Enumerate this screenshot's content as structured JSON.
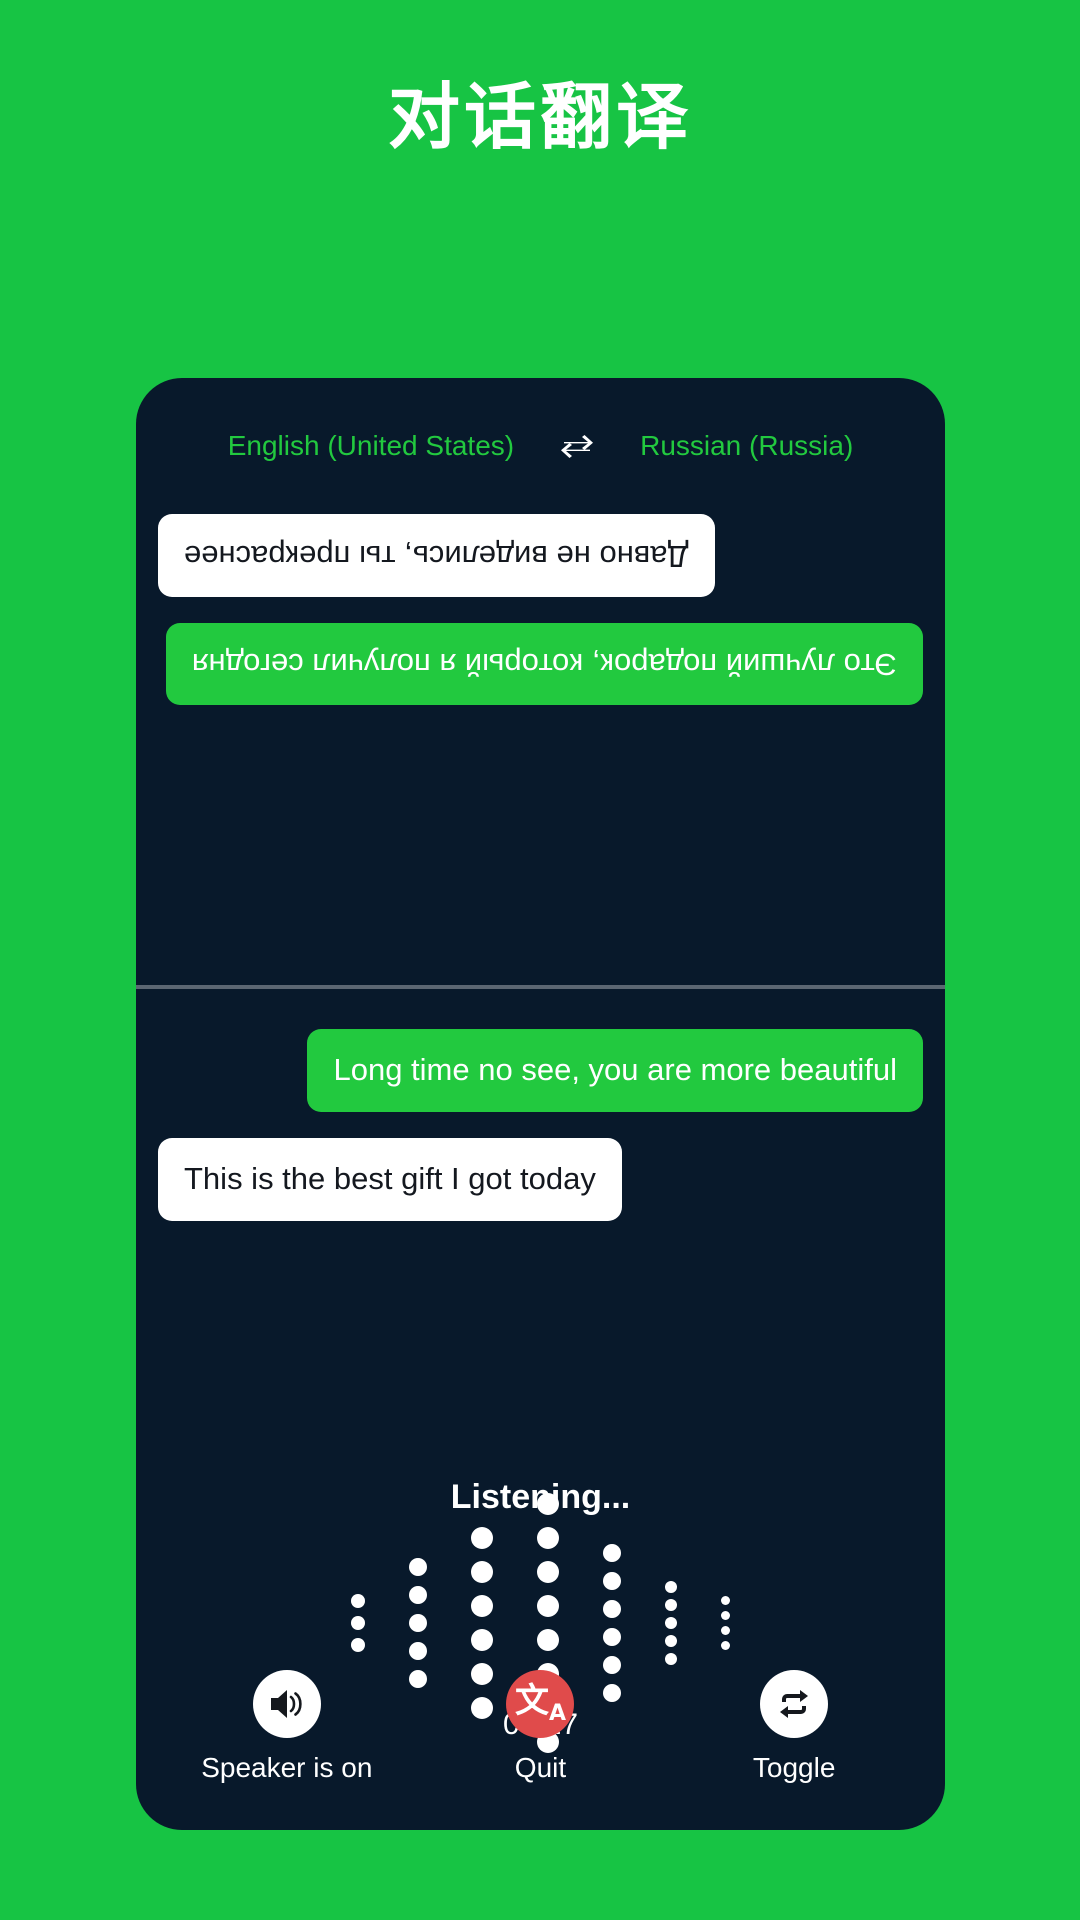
{
  "page": {
    "title": "对话翻译",
    "background_color": "#17c444",
    "card_color": "#08192b",
    "accent_green": "#22c93f",
    "accent_red": "#e04b4b"
  },
  "language_bar": {
    "source_language": "English (United States)",
    "target_language": "Russian (Russia)",
    "swap_icon": "swap-horizontal-icon"
  },
  "conversation": {
    "top_pane_rotated": true,
    "top_messages": [
      {
        "text": "Это лучший подарок, который я получил сегодня",
        "style": "green",
        "align": "left"
      },
      {
        "text": "Давно не виделись, ты прекраснее",
        "style": "white",
        "align": "right"
      }
    ],
    "bottom_messages": [
      {
        "text": "Long time no see, you are more beautiful",
        "style": "green",
        "align": "right"
      },
      {
        "text": "This is the best gift I got today",
        "style": "white",
        "align": "left"
      }
    ]
  },
  "status": {
    "listening_label": "Listening...",
    "timer": "00:17"
  },
  "waveform": {
    "columns": [
      {
        "dots": 3,
        "size": 14
      },
      {
        "dots": 5,
        "size": 18
      },
      {
        "dots": 6,
        "size": 22
      },
      {
        "dots": 8,
        "size": 22
      },
      {
        "dots": 6,
        "size": 18
      },
      {
        "dots": 5,
        "size": 12
      },
      {
        "dots": 4,
        "size": 9
      }
    ]
  },
  "controls": [
    {
      "label": "Speaker is on",
      "icon": "speaker-on-icon",
      "circle": "white",
      "name": "speaker-button"
    },
    {
      "label": "Quit",
      "icon": "translate-icon",
      "circle": "red",
      "name": "quit-button"
    },
    {
      "label": "Toggle",
      "icon": "repeat-icon",
      "circle": "white",
      "name": "toggle-button"
    }
  ]
}
